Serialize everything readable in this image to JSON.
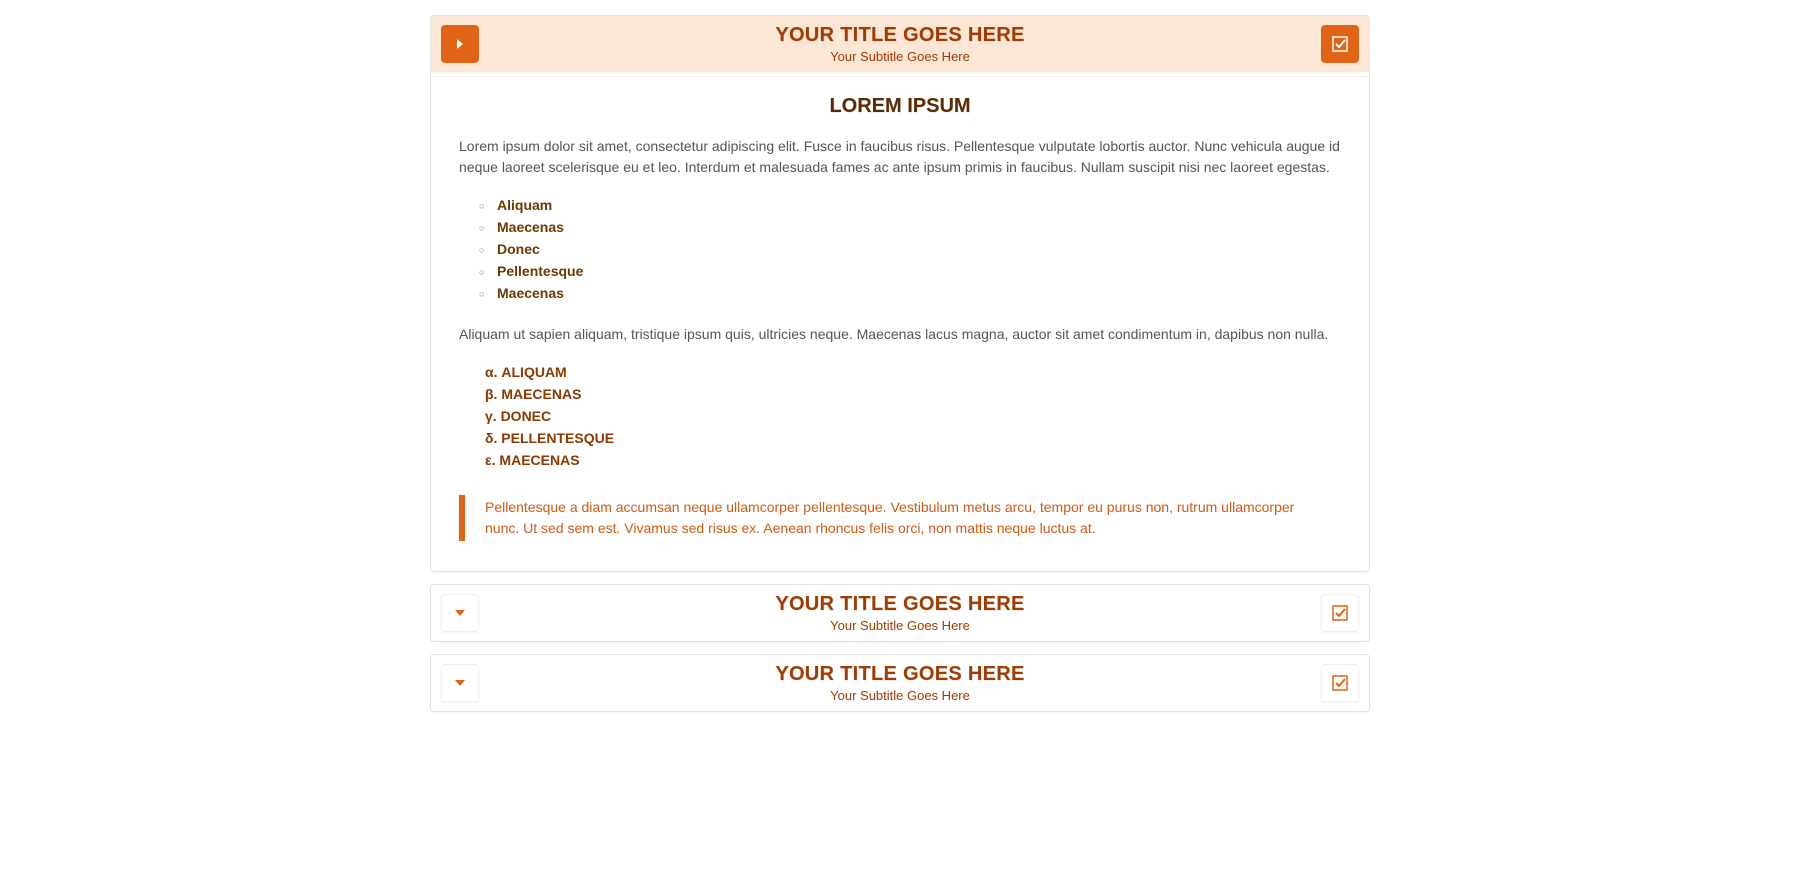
{
  "panels": [
    {
      "title": "YOUR TITLE GOES HERE",
      "subtitle": "Your Subtitle Goes Here",
      "expanded": true,
      "content": {
        "heading": "LOREM IPSUM",
        "paragraph1": "Lorem ipsum dolor sit amet, consectetur adipiscing elit. Fusce in faucibus risus. Pellentesque vulputate lobortis auctor. Nunc vehicula augue id neque laoreet scelerisque eu et leo. Interdum et malesuada fames ac ante ipsum primis in faucibus. Nullam suscipit nisi nec laoreet egestas.",
        "bullets": [
          "Aliquam",
          "Maecenas",
          "Donec",
          "Pellentesque",
          "Maecenas"
        ],
        "paragraph2": "Aliquam ut sapien aliquam, tristique ipsum quis, ultricies neque. Maecenas lacus magna, auctor sit amet condimentum in, dapibus non nulla.",
        "greek_items": [
          "α. ALIQUAM",
          "β. MAECENAS",
          "γ. DONEC",
          "δ. PELLENTESQUE",
          "ε. MAECENAS"
        ],
        "blockquote": "Pellentesque a diam accumsan neque ullamcorper pellentesque. Vestibulum metus arcu, tempor eu purus non, rutrum ullamcorper nunc. Ut sed sem est. Vivamus sed risus ex. Aenean rhoncus felis orci, non mattis neque luctus at."
      }
    },
    {
      "title": "YOUR TITLE GOES HERE",
      "subtitle": "Your Subtitle Goes Here",
      "expanded": false
    },
    {
      "title": "YOUR TITLE GOES HERE",
      "subtitle": "Your Subtitle Goes Here",
      "expanded": false
    }
  ],
  "colors": {
    "accent": "#e06316",
    "title_text": "#a23b00",
    "header_active_bg": "#fce6d6"
  }
}
